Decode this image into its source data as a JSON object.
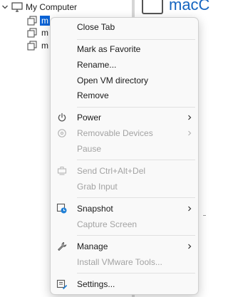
{
  "tree": {
    "root_label": "My Computer",
    "vms": [
      {
        "name": "m",
        "selected": true
      },
      {
        "name": "m",
        "selected": false
      },
      {
        "name": "m",
        "selected": false
      }
    ]
  },
  "main": {
    "title": "macC"
  },
  "context_menu": {
    "close_tab": "Close Tab",
    "mark_favorite": "Mark as Favorite",
    "rename": "Rename...",
    "open_vm_directory": "Open VM directory",
    "remove": "Remove",
    "power": "Power",
    "removable_devices": "Removable Devices",
    "pause": "Pause",
    "send_ctrl_alt_del": "Send Ctrl+Alt+Del",
    "grab_input": "Grab Input",
    "snapshot": "Snapshot",
    "capture_screen": "Capture Screen",
    "manage": "Manage",
    "install_vmware_tools": "Install VMware Tools...",
    "settings": "Settings..."
  },
  "icons": {
    "power": "power-icon",
    "removable_devices": "removable-devices-icon",
    "send_ctrl_alt_del": "keyboard-icon",
    "snapshot": "snapshot-icon",
    "manage": "wrench-icon",
    "settings": "settings-icon"
  },
  "colors": {
    "selection": "#0a63d6",
    "menu_background": "#f9f9f9",
    "disabled_text": "#a3a3a3",
    "accent_blue": "#1565c0"
  }
}
